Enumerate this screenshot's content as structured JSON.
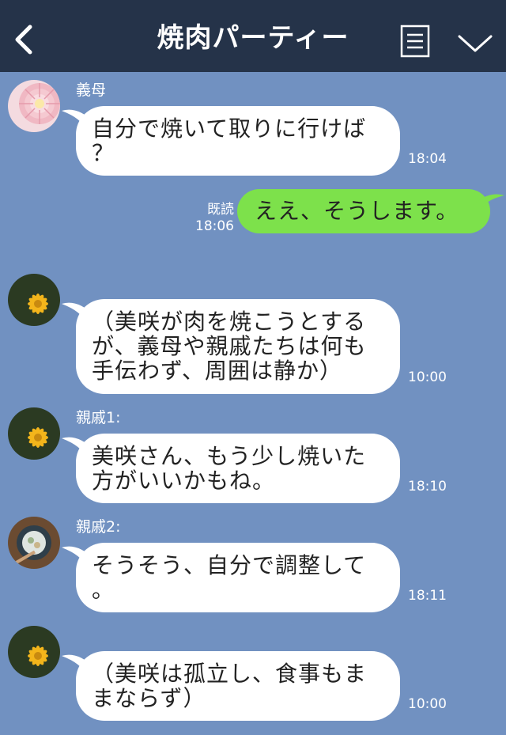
{
  "header": {
    "title": "焼肉パーティー"
  },
  "messages": [
    {
      "sender": "義母",
      "text": "自分で焼いて取りに行けば\n？",
      "time": "18:04"
    },
    {
      "sender": "",
      "text": "ええ、そうします。",
      "time": "18:06",
      "read": "既読",
      "mine": true
    },
    {
      "sender": "",
      "text": "（美咲が肉を焼こうとする\nが、義母や親戚たちは何も\n手伝わず、周囲は静か）",
      "time": "10:00"
    },
    {
      "sender": "親戚1:",
      "text": "美咲さん、もう少し焼いた\n方がいいかもね。",
      "time": "18:10"
    },
    {
      "sender": "親戚2:",
      "text": "そうそう、自分で調整して\n。",
      "time": "18:11"
    },
    {
      "sender": "",
      "text": "（美咲は孤立し、食事もま\nまならず）",
      "time": "10:00"
    }
  ]
}
